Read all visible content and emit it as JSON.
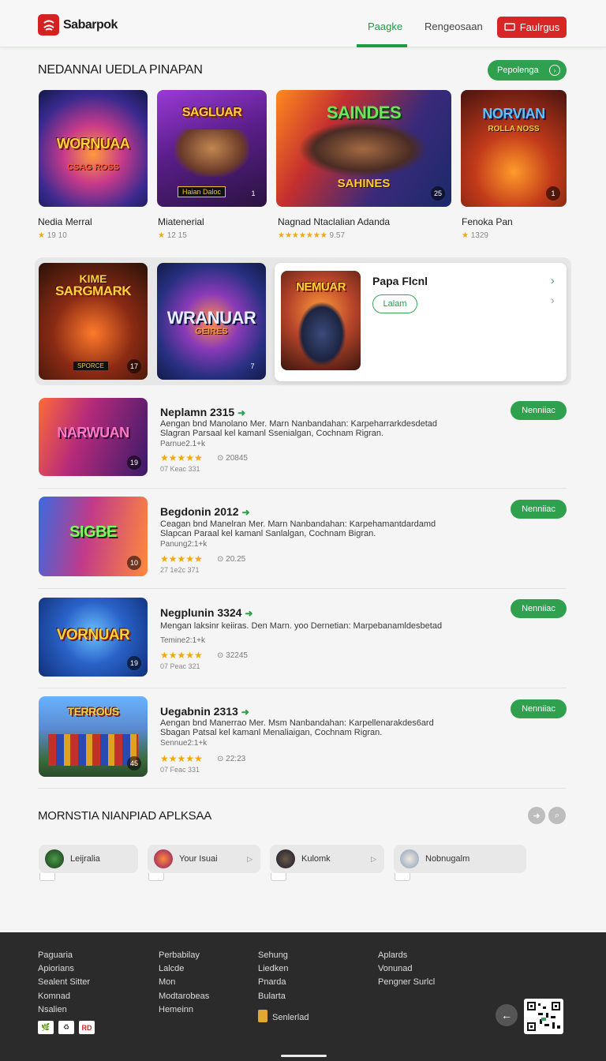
{
  "header": {
    "logo_text": "Sabarpok",
    "tabs": [
      {
        "label": "Paagke",
        "active": true
      },
      {
        "label": "Rengeosaan",
        "active": false
      }
    ],
    "action_button": "Faulrgus",
    "accent_green": "#1e9a48",
    "accent_red": "#d62626"
  },
  "top_section": {
    "title": "NEDANNAI UEDLA PINAPAN",
    "pill_label": "Pepolenga",
    "cards": [
      {
        "thumb_title": "WORNUAA",
        "thumb_sub": "CSAG ROSS",
        "corner": "",
        "name": "Nedia Merral",
        "rating": "19 10"
      },
      {
        "thumb_title": "SAGLUAR",
        "thumb_sub": "",
        "badge": "Haian Daloc",
        "corner": "1",
        "name": "Miatenerial",
        "rating": "12 15"
      },
      {
        "thumb_title": "SAINDES",
        "thumb_sub": "SAHINES",
        "corner": "25",
        "name": "Nagnad Ntaclalian Adanda",
        "rating": "9.57"
      },
      {
        "thumb_title": "NORVIAN",
        "thumb_sub": "ROLLA NOSS",
        "corner": "1",
        "name": "Fenoka Pan",
        "rating": "1329"
      }
    ]
  },
  "featured": {
    "thumbs": [
      {
        "thumb_title": "SARGMARK",
        "thumb_sub": "KIME",
        "badge": "SPORCE",
        "corner": "17"
      },
      {
        "thumb_title": "WRANUAR",
        "thumb_sub": "GEIRES",
        "corner": "7"
      }
    ],
    "card_thumb_title": "NEMUAR",
    "card_title": "Papa Flcnl",
    "card_bubble": "Lalam"
  },
  "list": [
    {
      "title": "Neplamn 2315",
      "desc1": "Aengan bnd Manolano  Mer. Marn Nanbandahan: Karpeharrarkdesdetad",
      "desc2": "Slagran Parsaal kel kamanl Ssenialgan, Cochnam Rigran.",
      "sub": "Parnue2.1+k",
      "count": "20845",
      "date": "07 Keac 331",
      "corner": "19",
      "thumb_title": "NARWUAN",
      "button": "Nenniiac"
    },
    {
      "title": "Begdonin 2012",
      "desc1": "Ceagan bnd Manelran  Mer. Marn Nanbandahan: Karpehamantdardamd",
      "desc2": "Slapcan Paraal kel kamanl Sanlalgan, Cochnam Bigran.",
      "sub": "Panung2:1+k",
      "count": "20.25",
      "date": "27 1e2c 371",
      "corner": "10",
      "thumb_title": "SIGBE",
      "button": "Nenniiac"
    },
    {
      "title": "Negplunin 3324",
      "desc1": "Mengan laksinr keiiras. Den Marn. yoo Dernetian: Marpebanamldesbetad",
      "desc2": "",
      "sub": "Temine2:1+k",
      "count": "32245",
      "date": "07 Peac 321",
      "corner": "19",
      "thumb_title": "VORNUAR",
      "button": "Nenniiac"
    },
    {
      "title": "Uegabnin 2313",
      "desc1": "Aengan bnd Manerrao  Mer. Msm Nanbandahan: Karpellenarakdes6ard",
      "desc2": "Sbagan Patsal kel kamanl Menaliaigan, Cochnam Rigran.",
      "sub": "Sennue2:1+k",
      "count": "22:23",
      "date": "07 Feac 331",
      "corner": "45",
      "thumb_title": "TERROUS",
      "button": "Nenniiac"
    }
  ],
  "categories": {
    "title": "MORNSTIA NIANPIAD APLKSAA",
    "chips": [
      {
        "label": "Leijralia"
      },
      {
        "label": "Your Isuai"
      },
      {
        "label": "Kulomk"
      },
      {
        "label": "Nobnugalm"
      }
    ]
  },
  "footer": {
    "col1": [
      "Paguaria",
      "Apiorians",
      "Sealent Sitter",
      "Komnad",
      "Nsalien"
    ],
    "col2": [
      "Perbabilay",
      "Lalcde",
      "Mon",
      "Modtarobeas",
      "Hemeinn"
    ],
    "col3": [
      "Sehung",
      "Liedken",
      "Pnarda",
      "Bularta"
    ],
    "col3_badge": "Senlerlad",
    "col4": [
      "Aplards",
      "Vonunad",
      "Pengner Surlcl"
    ],
    "badges": [
      "🌿",
      "♻",
      "RD"
    ]
  }
}
